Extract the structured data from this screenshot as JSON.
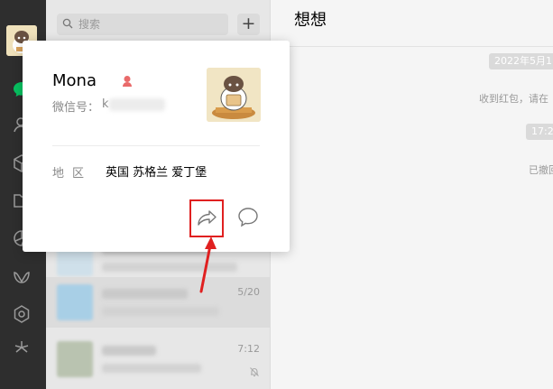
{
  "search": {
    "placeholder": "搜索",
    "add_button": "+"
  },
  "chat": {
    "title": "想想",
    "date_chip": "2022年5月1",
    "notice": "收到红包，请在",
    "time_chip": "17:2",
    "recalled": "已撤回"
  },
  "profile_card": {
    "name": "Mona",
    "wechat_id_label": "微信号：",
    "wechat_id_value": "k",
    "region_label": "地区",
    "region_value": "英国 苏格兰 爱丁堡"
  },
  "conversation_list": {
    "items": [
      {
        "time": ""
      },
      {
        "time": "5/20"
      },
      {
        "time": "7:12"
      }
    ]
  },
  "colors": {
    "sidebar": "#2e2e2e",
    "highlight": "#e02020",
    "active_green": "#07c160",
    "gender_female": "#e96a6a"
  },
  "icons": [
    "chat-icon",
    "contacts-icon",
    "favorites-icon",
    "files-icon",
    "moments-icon",
    "channels-icon",
    "miniprogram-icon",
    "search-feature-icon",
    "share-icon",
    "message-icon",
    "search-icon",
    "mute-icon",
    "female-icon"
  ]
}
